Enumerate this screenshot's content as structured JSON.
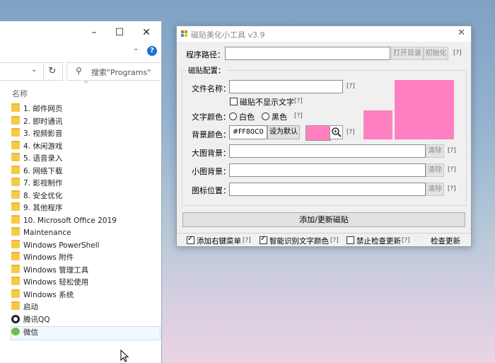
{
  "explorer": {
    "search_placeholder": "搜索\"Programs\"",
    "column_name": "名称",
    "items": [
      {
        "label": "1. 邮件网页",
        "icon": "folder"
      },
      {
        "label": "2. 即时通讯",
        "icon": "folder"
      },
      {
        "label": "3. 视频影音",
        "icon": "folder"
      },
      {
        "label": "4. 休闲游戏",
        "icon": "folder"
      },
      {
        "label": "5. 语音录入",
        "icon": "folder"
      },
      {
        "label": "6. 网络下载",
        "icon": "folder"
      },
      {
        "label": "7. 影视制作",
        "icon": "folder"
      },
      {
        "label": "8. 安全优化",
        "icon": "folder"
      },
      {
        "label": "9. 其他程序",
        "icon": "folder"
      },
      {
        "label": "10. Microsoft Office 2019",
        "icon": "folder"
      },
      {
        "label": "Maintenance",
        "icon": "folder"
      },
      {
        "label": "Windows PowerShell",
        "icon": "folder"
      },
      {
        "label": "Windows 附件",
        "icon": "folder"
      },
      {
        "label": "Windows 管理工具",
        "icon": "folder"
      },
      {
        "label": "Windows 轻松使用",
        "icon": "folder"
      },
      {
        "label": "Windows 系统",
        "icon": "folder"
      },
      {
        "label": "启动",
        "icon": "folder"
      },
      {
        "label": "腾讯QQ",
        "icon": "qq-icon"
      },
      {
        "label": "微信",
        "icon": "wechat-icon"
      }
    ]
  },
  "dialog": {
    "title": "磁贴美化小工具 v3.9",
    "program_path_label": "程序路径：",
    "program_path_value": "",
    "open_dir_button": "打开目录",
    "init_button": "初始化",
    "help": "[?]",
    "group_caption": "磁贴配置：",
    "file_name_label": "文件名称：",
    "file_name_value": "",
    "hide_text_checkbox": "磁贴不显示文字",
    "text_color_label": "文字颜色：",
    "text_color_white": "白色",
    "text_color_black": "黑色",
    "bg_color_label": "背景颜色：",
    "bg_color_value": "#FF80C0",
    "set_default_button": "设为默认",
    "big_bg_label": "大图背景：",
    "small_bg_label": "小图背景：",
    "icon_pos_label": "图标位置：",
    "clear_button": "清除",
    "add_update_button": "添加/更新磁贴",
    "add_context_menu": "添加右键菜单",
    "smart_text_color": "智能识别文字颜色",
    "disable_update_check": "禁止检查更新",
    "check_update": "检查更新",
    "colors": {
      "preview": "#FF80C0"
    }
  }
}
